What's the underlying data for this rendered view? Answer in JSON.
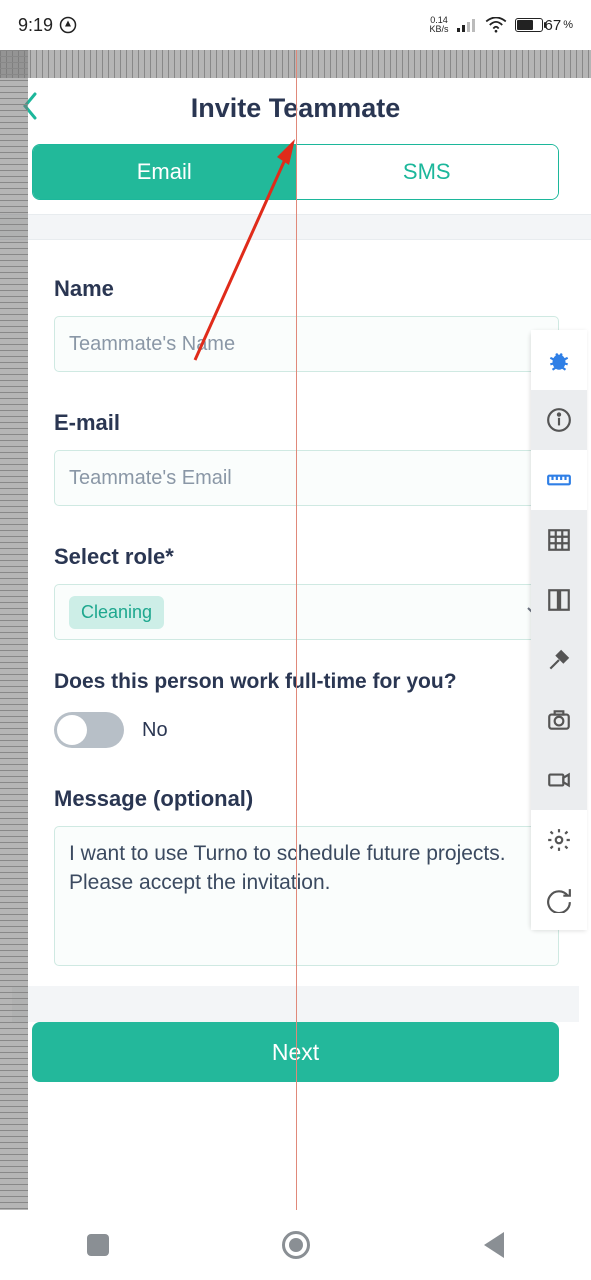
{
  "status": {
    "time": "9:19",
    "net_rate": "0.14",
    "net_unit": "KB/s",
    "battery": "67"
  },
  "header": {
    "title": "Invite Teammate"
  },
  "tabs": {
    "email": "Email",
    "sms": "SMS"
  },
  "form": {
    "name_label": "Name",
    "name_placeholder": "Teammate's Name",
    "email_label": "E-mail",
    "email_placeholder": "Teammate's Email",
    "role_label": "Select role*",
    "role_value": "Cleaning",
    "fulltime_question": "Does this person work full-time for you?",
    "fulltime_value": "No",
    "message_label": "Message (optional)",
    "message_value": "I want to use Turno to schedule future projects. Please accept the invitation."
  },
  "footer": {
    "next": "Next"
  },
  "debug_toolbar": {
    "items": [
      "bug-icon",
      "info-icon",
      "ruler-icon",
      "grid-icon",
      "column-icon",
      "eyedropper-icon",
      "camera-icon",
      "video-icon",
      "settings-icon",
      "redo-icon"
    ]
  }
}
